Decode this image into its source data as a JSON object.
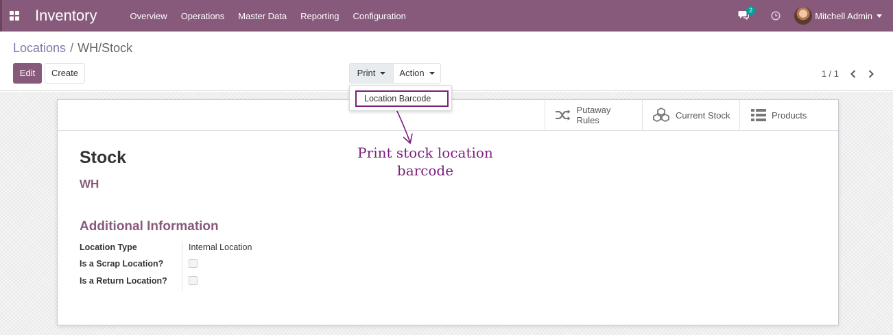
{
  "navbar": {
    "app_name": "Inventory",
    "menu": [
      "Overview",
      "Operations",
      "Master Data",
      "Reporting",
      "Configuration"
    ],
    "chat_count": "2",
    "user_name": "Mitchell Admin"
  },
  "breadcrumb": {
    "parent": "Locations",
    "separator": "/",
    "current": "WH/Stock"
  },
  "toolbar": {
    "edit_label": "Edit",
    "create_label": "Create",
    "print_label": "Print",
    "action_label": "Action"
  },
  "print_menu": {
    "items": [
      "Location Barcode"
    ]
  },
  "pager": {
    "value": "1 / 1"
  },
  "smart_buttons": {
    "putaway": "Putaway Rules",
    "current_stock": "Current Stock",
    "products": "Products"
  },
  "record": {
    "name": "Stock",
    "parent": "WH",
    "section_title": "Additional Information",
    "fields": {
      "location_type_label": "Location Type",
      "location_type_value": "Internal Location",
      "scrap_label": "Is a Scrap Location?",
      "scrap_checked": false,
      "return_label": "Is a Return Location?",
      "return_checked": false
    }
  },
  "annotation": {
    "line1": "Print stock location",
    "line2": "barcode"
  },
  "colors": {
    "brand": "#875a7b",
    "link": "#7c7bad",
    "annotation": "#7b1e7a",
    "badge": "#00a09d"
  }
}
